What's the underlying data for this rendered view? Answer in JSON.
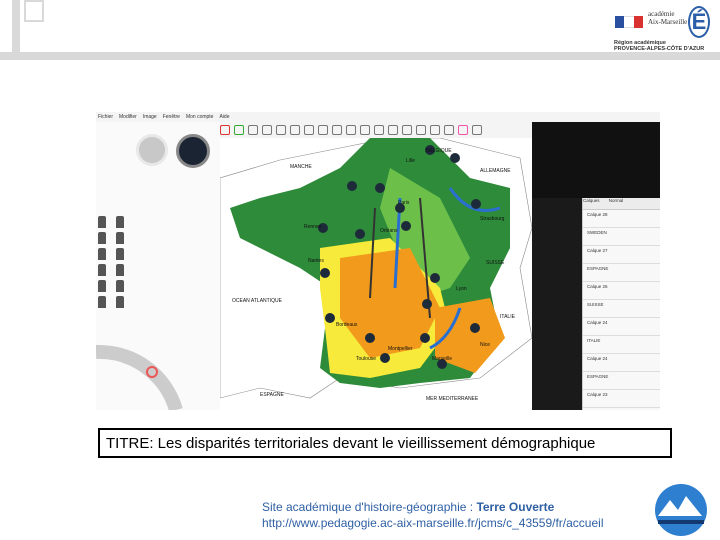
{
  "header": {
    "logo_line1": "académie",
    "logo_line2": "Aix-Marseille",
    "logo_letter": "É",
    "region_line1": "Région académique",
    "region_line2": "PROVENCE-ALPES-CÔTE D'AZUR"
  },
  "app": {
    "menu": [
      "Fichier",
      "Modifier",
      "Image",
      "Fenêtre",
      "Mon compte",
      "Aide"
    ],
    "panel_title": "Calques",
    "panel_dropdown": "Normal",
    "layers": [
      "Calque 28",
      "SWEDEN",
      "Calque 27",
      "ESPAGNE",
      "Calque 26",
      "SUISSE",
      "Calque 24",
      "ITALIE",
      "Calque 24",
      "ESPAGNE",
      "Calque 23"
    ]
  },
  "map": {
    "labels": [
      "BELGIQUE",
      "Lille",
      "MANCHE",
      "ALLEMAGNE",
      "Paris",
      "Strasbourg",
      "Nantes",
      "Orléans",
      "Rennes",
      "SUISSE",
      "OCEAN ATLANTIQUE",
      "Lyon",
      "ITALIE",
      "Bordeaux",
      "Nice",
      "Toulouse",
      "Montpellier",
      "Marseille",
      "ESPAGNE",
      "MER MEDITERRANEE"
    ]
  },
  "slide": {
    "title": "TITRE: Les disparités territoriales devant le vieillissement démographique",
    "footer_prefix": "Site académique d'histoire-géographie : ",
    "footer_site": "Terre Ouverte",
    "footer_url": "http://www.pedagogie.ac-aix-marseille.fr/jcms/c_43559/fr/accueil"
  },
  "colors": {
    "dark_green": "#2e8b3a",
    "light_green": "#6cc04a",
    "orange": "#f29a1b",
    "yellow": "#f7ea3a",
    "arrow_blue": "#2a6fd0"
  }
}
